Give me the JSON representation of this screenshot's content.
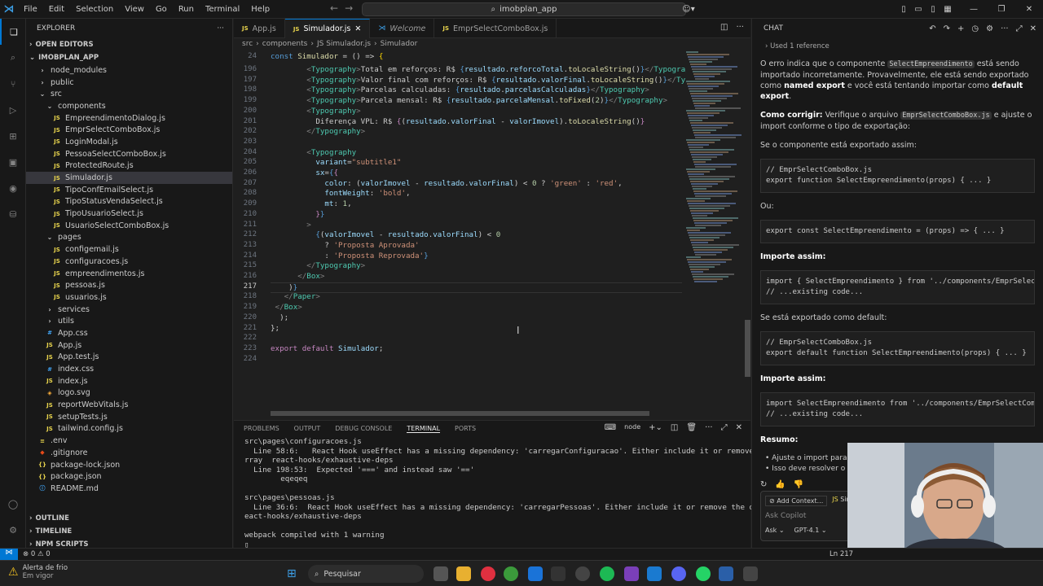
{
  "titlebar": {
    "menu": [
      "File",
      "Edit",
      "Selection",
      "View",
      "Go",
      "Run",
      "Terminal",
      "Help"
    ],
    "search": "imobplan_app"
  },
  "sidebar": {
    "title": "EXPLORER",
    "open_editors": "OPEN EDITORS",
    "project": "IMOBPLAN_APP",
    "tree": [
      {
        "label": "node_modules",
        "type": "folder",
        "indent": 1
      },
      {
        "label": "public",
        "type": "folder",
        "indent": 1
      },
      {
        "label": "src",
        "type": "folder-open",
        "indent": 1
      },
      {
        "label": "components",
        "type": "folder-open",
        "indent": 2
      },
      {
        "label": "EmpreendimentoDialog.js",
        "type": "js",
        "indent": 3
      },
      {
        "label": "EmprSelectComboBox.js",
        "type": "js",
        "indent": 3
      },
      {
        "label": "LoginModal.js",
        "type": "js",
        "indent": 3
      },
      {
        "label": "PessoaSelectComboBox.js",
        "type": "js",
        "indent": 3
      },
      {
        "label": "ProtectedRoute.js",
        "type": "js",
        "indent": 3
      },
      {
        "label": "Simulador.js",
        "type": "js",
        "indent": 3,
        "selected": true
      },
      {
        "label": "TipoConfEmailSelect.js",
        "type": "js",
        "indent": 3
      },
      {
        "label": "TipoStatusVendaSelect.js",
        "type": "js",
        "indent": 3
      },
      {
        "label": "TipoUsuarioSelect.js",
        "type": "js",
        "indent": 3
      },
      {
        "label": "UsuarioSelectComboBox.js",
        "type": "js",
        "indent": 3
      },
      {
        "label": "pages",
        "type": "folder-open",
        "indent": 2
      },
      {
        "label": "configemail.js",
        "type": "js",
        "indent": 3
      },
      {
        "label": "configuracoes.js",
        "type": "js",
        "indent": 3
      },
      {
        "label": "empreendimentos.js",
        "type": "js",
        "indent": 3
      },
      {
        "label": "pessoas.js",
        "type": "js",
        "indent": 3
      },
      {
        "label": "usuarios.js",
        "type": "js",
        "indent": 3
      },
      {
        "label": "services",
        "type": "folder",
        "indent": 2
      },
      {
        "label": "utils",
        "type": "folder",
        "indent": 2
      },
      {
        "label": "App.css",
        "type": "css",
        "indent": 2
      },
      {
        "label": "App.js",
        "type": "js",
        "indent": 2
      },
      {
        "label": "App.test.js",
        "type": "js",
        "indent": 2
      },
      {
        "label": "index.css",
        "type": "css",
        "indent": 2
      },
      {
        "label": "index.js",
        "type": "js",
        "indent": 2
      },
      {
        "label": "logo.svg",
        "type": "svg",
        "indent": 2
      },
      {
        "label": "reportWebVitals.js",
        "type": "js",
        "indent": 2
      },
      {
        "label": "setupTests.js",
        "type": "js",
        "indent": 2
      },
      {
        "label": "tailwind.config.js",
        "type": "js",
        "indent": 2
      },
      {
        "label": ".env",
        "type": "env",
        "indent": 1
      },
      {
        "label": ".gitignore",
        "type": "git",
        "indent": 1
      },
      {
        "label": "package-lock.json",
        "type": "json",
        "indent": 1
      },
      {
        "label": "package.json",
        "type": "json",
        "indent": 1
      },
      {
        "label": "README.md",
        "type": "info",
        "indent": 1
      }
    ],
    "outline": "OUTLINE",
    "timeline": "TIMELINE",
    "npm": "NPM SCRIPTS"
  },
  "tabs": [
    {
      "label": "App.js",
      "icon": "JS"
    },
    {
      "label": "Simulador.js",
      "icon": "JS",
      "active": true
    },
    {
      "label": "Welcome",
      "icon": "vscode"
    },
    {
      "label": "EmprSelectComboBox.js",
      "icon": "JS"
    }
  ],
  "breadcrumb": [
    "src",
    "components",
    "JS Simulador.js",
    "Simulador"
  ],
  "code": {
    "sticky_line": "24",
    "sticky_text": "const Simulador = () => {",
    "lines": [
      {
        "n": "196",
        "h": "        <span class='p'>&lt;</span><span class='t'>Typography</span><span class='p'>&gt;</span>Total em reforços: R$ <span class='k'>{</span><span class='v'>resultado</span>.<span class='v'>reforcoTotal</span>.<span class='f'>toLocaleString</span>()<span class='k'>}</span><span class='p'>&lt;/</span><span class='t'>Typography</span><span class='p'>&gt;</span>"
      },
      {
        "n": "197",
        "h": "        <span class='p'>&lt;</span><span class='t'>Typography</span><span class='p'>&gt;</span>Valor final com reforços: R$ <span class='k'>{</span><span class='v'>resultado</span>.<span class='v'>valorFinal</span>.<span class='f'>toLocaleString</span>()<span class='k'>}</span><span class='p'>&lt;/</span><span class='t'>Typography</span>"
      },
      {
        "n": "198",
        "h": "        <span class='p'>&lt;</span><span class='t'>Typography</span><span class='p'>&gt;</span>Parcelas calculadas: <span class='k'>{</span><span class='v'>resultado</span>.<span class='v'>parcelasCalculadas</span><span class='k'>}</span><span class='p'>&lt;/</span><span class='t'>Typography</span><span class='p'>&gt;</span>"
      },
      {
        "n": "199",
        "h": "        <span class='p'>&lt;</span><span class='t'>Typography</span><span class='p'>&gt;</span>Parcela mensal: R$ <span class='k'>{</span><span class='v'>resultado</span>.<span class='v'>parcelaMensal</span>.<span class='f'>toFixed</span>(<span class='n'>2</span>)<span class='k'>}</span><span class='p'>&lt;/</span><span class='t'>Typography</span><span class='p'>&gt;</span>"
      },
      {
        "n": "200",
        "h": "        <span class='p'>&lt;</span><span class='t'>Typography</span><span class='p'>&gt;</span>"
      },
      {
        "n": "201",
        "h": "          Diferença VPL: R$ <span class='kw'>{</span>(<span class='v'>resultado</span>.<span class='v'>valorFinal</span> - <span class='v'>valorImovel</span>).<span class='f'>toLocaleString</span>()<span class='kw'>}</span>"
      },
      {
        "n": "202",
        "h": "        <span class='p'>&lt;/</span><span class='t'>Typography</span><span class='p'>&gt;</span>"
      },
      {
        "n": "203",
        "h": ""
      },
      {
        "n": "204",
        "h": "        <span class='p'>&lt;</span><span class='t'>Typography</span>"
      },
      {
        "n": "205",
        "h": "          <span class='a'>variant</span>=<span class='s'>\"subtitle1\"</span>"
      },
      {
        "n": "206",
        "h": "          <span class='a'>sx</span>=<span class='k'>{</span><span class='kw'>{</span>"
      },
      {
        "n": "207",
        "h": "            <span class='a'>color</span>: (<span class='v'>valorImovel</span> - <span class='v'>resultado</span>.<span class='v'>valorFinal</span>) &lt; <span class='n'>0</span> ? <span class='s'>'green'</span> : <span class='s'>'red'</span>,"
      },
      {
        "n": "208",
        "h": "            <span class='a'>fontWeight</span>: <span class='s'>'bold'</span>,"
      },
      {
        "n": "209",
        "h": "            <span class='a'>mt</span>: <span class='n'>1</span>,"
      },
      {
        "n": "210",
        "h": "          <span class='kw'>}</span><span class='k'>}</span>"
      },
      {
        "n": "211",
        "h": "        <span class='p'>&gt;</span>"
      },
      {
        "n": "212",
        "h": "          <span class='k'>{</span>(<span class='v'>valorImovel</span> - <span class='v'>resultado</span>.<span class='v'>valorFinal</span>) &lt; <span class='n'>0</span>"
      },
      {
        "n": "213",
        "h": "            ? <span class='s'>'Proposta Aprovada'</span>"
      },
      {
        "n": "214",
        "h": "            : <span class='s'>'Proposta Reprovada'</span><span class='k'>}</span>"
      },
      {
        "n": "215",
        "h": "        <span class='p'>&lt;/</span><span class='t'>Typography</span><span class='p'>&gt;</span>"
      },
      {
        "n": "216",
        "h": "      <span class='p'>&lt;/</span><span class='t'>Box</span><span class='p'>&gt;</span>"
      },
      {
        "n": "217",
        "h": "    )<span class='k'>}</span>"
      },
      {
        "n": "218",
        "h": "   <span class='p'>&lt;/</span><span class='t'>Paper</span><span class='p'>&gt;</span>"
      },
      {
        "n": "219",
        "h": " <span class='p'>&lt;/</span><span class='t'>Box</span><span class='p'>&gt;</span>"
      },
      {
        "n": "220",
        "h": "  );"
      },
      {
        "n": "221",
        "h": "};"
      },
      {
        "n": "222",
        "h": ""
      },
      {
        "n": "223",
        "h": "<span class='kw'>export</span> <span class='kw'>default</span> <span class='v'>Simulador</span>;"
      },
      {
        "n": "224",
        "h": ""
      }
    ]
  },
  "panel": {
    "tabs": [
      "PROBLEMS",
      "OUTPUT",
      "DEBUG CONSOLE",
      "TERMINAL",
      "PORTS"
    ],
    "active": "TERMINAL",
    "shell": "node",
    "terminal": [
      "src\\pages\\configuracoes.js",
      "  Line 58:6:   React Hook useEffect has a missing dependency: 'carregarConfiguracao'. Either include it or remove the dependency a",
      "rray  react-hooks/exhaustive-deps",
      "  Line 198:53:  Expected '===' and instead saw '=='",
      "        eqeqeq",
      "",
      "src\\pages\\pessoas.js",
      "  Line 36:6:  React Hook useEffect has a missing dependency: 'carregarPessoas'. Either include it or remove the dependency array  r",
      "eact-hooks/exhaustive-deps",
      "",
      "webpack compiled with 1 warning"
    ]
  },
  "chat": {
    "title": "CHAT",
    "used_ref": "Used 1 reference",
    "p1a": "O erro indica que o componente",
    "p1code": "SelectEmpreendimento",
    "p1b": "está sendo importado incorretamente. Provavelmente, ele está sendo exportado como",
    "p1c": "named export",
    "p1d": "e você está tentando importar como",
    "p1e": "default export",
    "p2a": "Como corrigir:",
    "p2b": "Verifique o arquivo",
    "p2code": "EmprSelectComboBox.js",
    "p2c": "e ajuste o import conforme o tipo de exportação:",
    "p3": "Se o componente está exportado assim:",
    "code1": "// EmprSelectComboBox.js\nexport function SelectEmpreendimento(props) { ... }",
    "ou": "Ou:",
    "code2": "export const SelectEmpreendimento = (props) => { ... }",
    "import1": "Importe assim:",
    "code3": "import { SelectEmpreendimento } from '../components/EmprSelectCo\n// ...existing code...",
    "p4": "Se está exportado como default:",
    "code4": "// EmprSelectComboBox.js\nexport default function SelectEmpreendimento(props) { ... }",
    "import2": "Importe assim:",
    "code5": "import SelectEmpreendimento from '../components/EmprSelectCombo\n// ...existing code...",
    "resumo": "Resumo:",
    "bullet1": "Ajuste o import para co",
    "bullet2": "Isso deve resolver o erro",
    "add_context": "Add Context...",
    "file_chip": "Simula",
    "ask_placeholder": "Ask Copilot",
    "mode": "Ask",
    "model": "GPT-4.1"
  },
  "status": {
    "errors": "0",
    "warnings": "0",
    "position": "Ln 217",
    "weather_title": "Alerta de frio",
    "weather_sub": "Em vigor"
  },
  "taskbar": {
    "search": "Pesquisar"
  }
}
